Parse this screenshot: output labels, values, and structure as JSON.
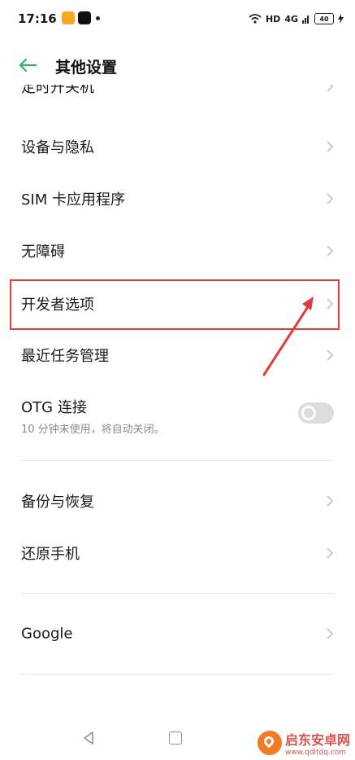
{
  "status_bar": {
    "time": "17:16",
    "network": "HD",
    "signal": "4G",
    "battery": "40"
  },
  "header": {
    "title": "其他设置"
  },
  "menu": {
    "items": [
      {
        "label": "定时开关机"
      },
      {
        "label": "设备与隐私"
      },
      {
        "label": "SIM 卡应用程序"
      },
      {
        "label": "无障碍"
      },
      {
        "label": "开发者选项"
      },
      {
        "label": "最近任务管理"
      }
    ],
    "otg": {
      "label": "OTG 连接",
      "sub": "10 分钟未使用，将自动关闭。",
      "enabled": false
    },
    "section2": [
      {
        "label": "备份与恢复"
      },
      {
        "label": "还原手机"
      }
    ],
    "section3": [
      {
        "label": "Google"
      }
    ]
  },
  "watermark": {
    "title": "启东安卓网",
    "url": "www.qdltdq.com"
  },
  "colors": {
    "accent": "#2bb36b",
    "highlight": "#e23b3b"
  }
}
